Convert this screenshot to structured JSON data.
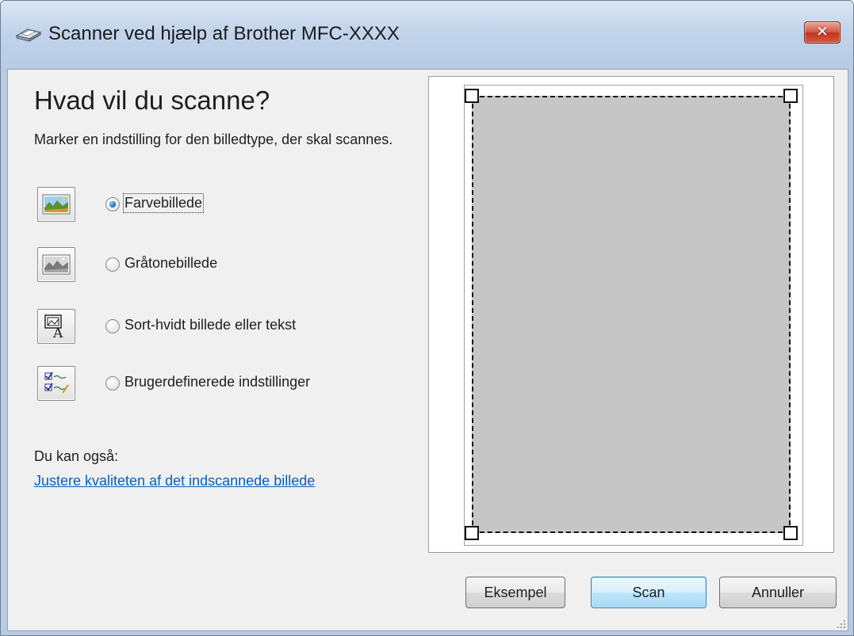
{
  "window": {
    "title": "Scanner ved hjælp af Brother MFC-XXXX",
    "close_label": "✕"
  },
  "main": {
    "heading": "Hvad vil du scanne?",
    "description": "Marker en indstilling for den billedtype, der skal scannes.",
    "options": [
      {
        "label": "Farvebillede",
        "selected": true,
        "icon": "color-picture-icon"
      },
      {
        "label": "Gråtonebillede",
        "selected": false,
        "icon": "grayscale-picture-icon"
      },
      {
        "label": "Sort-hvidt billede eller tekst",
        "selected": false,
        "icon": "black-white-text-icon"
      },
      {
        "label": "Brugerdefinerede indstillinger",
        "selected": false,
        "icon": "custom-settings-icon"
      }
    ],
    "also_label": "Du kan også:",
    "adjust_link": "Justere kvaliteten af det indscannede billede"
  },
  "preview": {
    "icon": "scan-preview-area"
  },
  "buttons": {
    "preview": "Eksempel",
    "scan": "Scan",
    "cancel": "Annuller"
  },
  "colors": {
    "link": "#0a5fb8",
    "scan_area": "#c6c6c6",
    "close_button": "#c0341f"
  }
}
